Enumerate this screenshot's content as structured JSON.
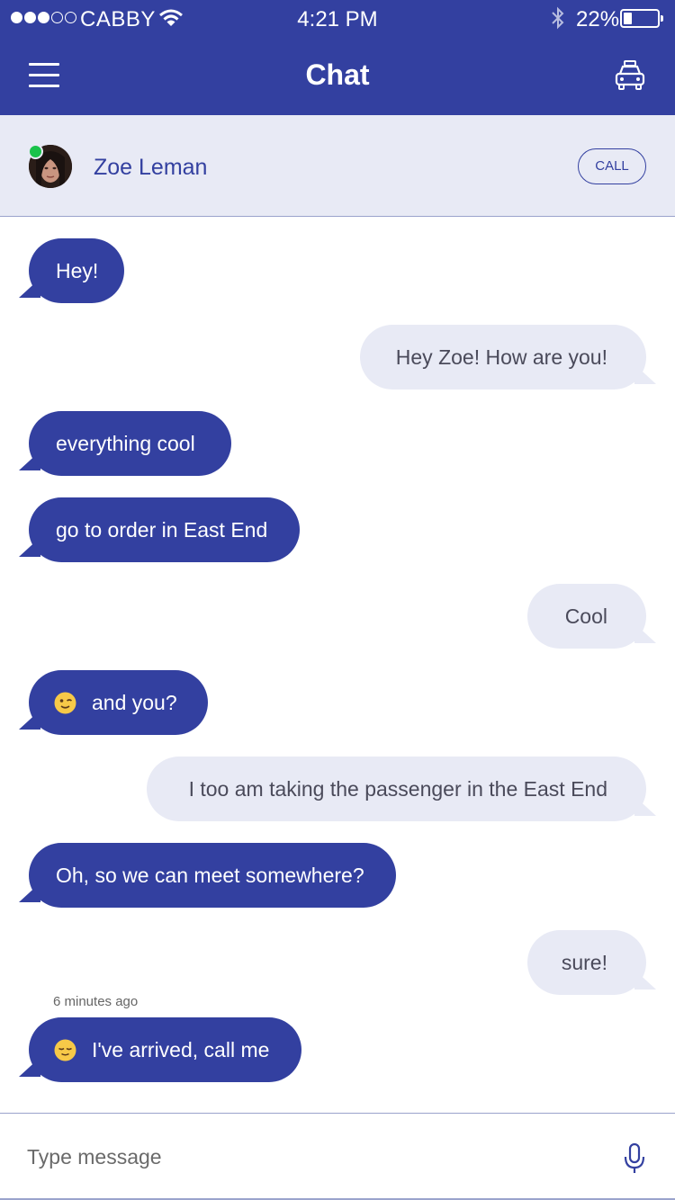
{
  "status_bar": {
    "carrier": "CABBY",
    "time": "4:21 PM",
    "battery": "22%",
    "battery_level": 0.22,
    "signal_bars": 3,
    "signal_total": 5
  },
  "header": {
    "title": "Chat",
    "menu_icon": "hamburger-icon",
    "right_icon": "taxi-icon"
  },
  "contact": {
    "name": "Zoe Leman",
    "status": "online",
    "call_label": "CALL"
  },
  "messages": [
    {
      "dir": "in",
      "text": "Hey!"
    },
    {
      "dir": "out",
      "text": "Hey Zoe! How are you!"
    },
    {
      "dir": "in",
      "text": "everything cool"
    },
    {
      "dir": "in",
      "text": "go to order in East End"
    },
    {
      "dir": "out",
      "text": "Cool"
    },
    {
      "dir": "in",
      "emoji": "winking-face-icon",
      "text": "and you?"
    },
    {
      "dir": "out",
      "text": "I too am taking the passenger in the East End"
    },
    {
      "dir": "in",
      "text": "Oh, so we can meet somewhere?"
    },
    {
      "dir": "out",
      "text": "sure!"
    },
    {
      "dir": "in",
      "emoji": "relieved-face-icon",
      "text": "I've arrived, call me"
    }
  ],
  "last_timestamp": "6 minutes ago",
  "composer": {
    "placeholder": "Type message",
    "value": "",
    "mic_icon": "microphone-icon"
  },
  "colors": {
    "primary": "#3340a0",
    "light": "#e8eaf5",
    "online": "#19c24a"
  }
}
